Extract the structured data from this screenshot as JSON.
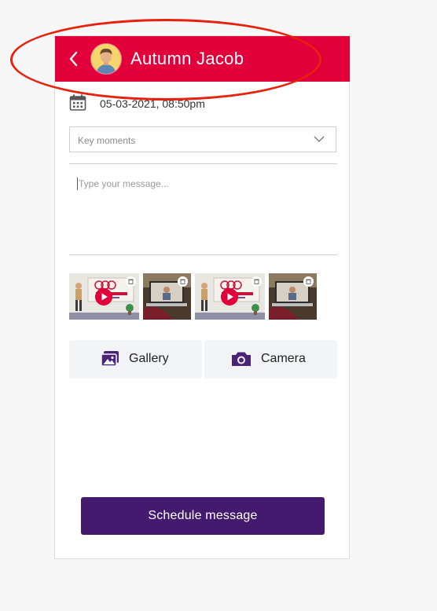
{
  "header": {
    "contact_name": "Autumn Jacob",
    "background": "#e2003b",
    "back_icon": "chevron-left-icon",
    "avatar_icon": "user-avatar"
  },
  "schedule": {
    "date_time": "05-03-2021, 08:50pm",
    "calendar_icon": "calendar-icon"
  },
  "category_dropdown": {
    "selected": "Key moments",
    "icon": "chevron-down-icon"
  },
  "message": {
    "placeholder": "Type your message...",
    "value": ""
  },
  "attachments": [
    {
      "type": "video",
      "description": "animated presenter thumbnail"
    },
    {
      "type": "image",
      "description": "laptop video call thumbnail"
    },
    {
      "type": "video",
      "description": "animated presenter thumbnail"
    },
    {
      "type": "image",
      "description": "laptop video call thumbnail"
    }
  ],
  "media_buttons": {
    "gallery_label": "Gallery",
    "gallery_icon": "gallery-icon",
    "camera_label": "Camera",
    "camera_icon": "camera-icon"
  },
  "submit": {
    "label": "Schedule message",
    "color": "#431a6e"
  },
  "annotation": {
    "color": "#e8200e"
  }
}
